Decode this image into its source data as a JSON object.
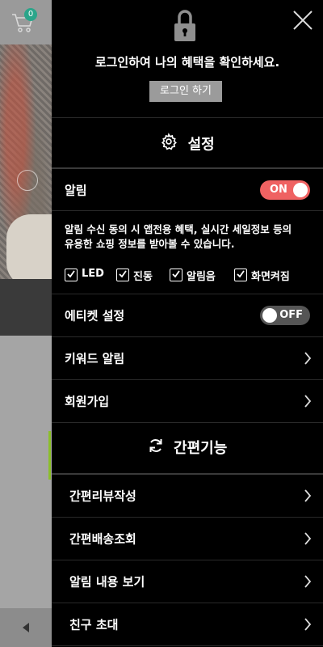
{
  "background_page": {
    "cart_badge": "0"
  },
  "drawer": {
    "login_message": "로그인하여 나의 혜택을 확인하세요.",
    "login_button": "로그인 하기",
    "settings_title": "설정",
    "notifications": {
      "label": "알림",
      "toggle_state": "ON",
      "description_line1": "알림 수신 동의 시 앱전용 혜택, 실시간 세일정보 등의",
      "description_line2": "유용한 쇼핑 정보를 받아볼 수 있습니다.",
      "options": [
        {
          "label": "LED",
          "checked": true
        },
        {
          "label": "진동",
          "checked": true
        },
        {
          "label": "알림음",
          "checked": true
        },
        {
          "label": "화면켜짐",
          "checked": true
        }
      ]
    },
    "etiquette": {
      "label": "에티켓 설정",
      "toggle_state": "OFF"
    },
    "keyword_alert": "키워드 알림",
    "signup": "회원가입",
    "quick_title": "간편기능",
    "quick_items": [
      {
        "label": "간편리뷰작성"
      },
      {
        "label": "간편배송조회"
      },
      {
        "label": "알림 내용 보기"
      },
      {
        "label": "친구 초대"
      }
    ]
  },
  "colors": {
    "toggle_on": "#ef6262",
    "toggle_off": "#555555",
    "login_button_bg": "#9b9b9b",
    "badge": "#2ba58a"
  }
}
